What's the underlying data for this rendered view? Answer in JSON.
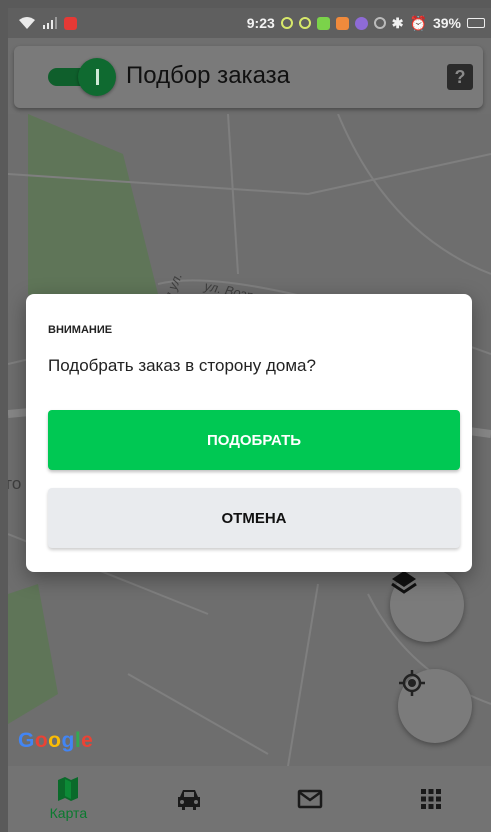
{
  "status_bar": {
    "time": "9:23",
    "battery": "39%",
    "icons": [
      "wifi-icon",
      "signal-icon",
      "app-notification-icon",
      "notification-icons",
      "bluetooth-icon",
      "alarm-icon",
      "battery-icon"
    ]
  },
  "top_bar": {
    "title": "Подбор заказа",
    "toggle_on": true,
    "help_label": "?"
  },
  "map": {
    "street_label": "ул. Возро",
    "street_label_2": "ая ул.",
    "left_edge_label": "го",
    "google_letters": [
      "G",
      "o",
      "o",
      "g",
      "l",
      "e"
    ],
    "google_colors": [
      "#4285F4",
      "#EA4335",
      "#FBBC05",
      "#4285F4",
      "#34A853",
      "#EA4335"
    ]
  },
  "dialog": {
    "title": "ВНИМАНИЕ",
    "message": "Подобрать заказ в сторону дома?",
    "confirm_label": "ПОДОБРАТЬ",
    "cancel_label": "ОТМЕНА"
  },
  "bottom_nav": {
    "items": [
      {
        "label": "Карта",
        "icon": "map-icon",
        "active": true
      },
      {
        "label": "",
        "icon": "taxi-icon",
        "active": false
      },
      {
        "label": "",
        "icon": "mail-icon",
        "active": false
      },
      {
        "label": "",
        "icon": "grid-menu-icon",
        "active": false
      }
    ]
  },
  "colors": {
    "accent": "#00c853",
    "accent_dark": "#0a7a2f"
  }
}
